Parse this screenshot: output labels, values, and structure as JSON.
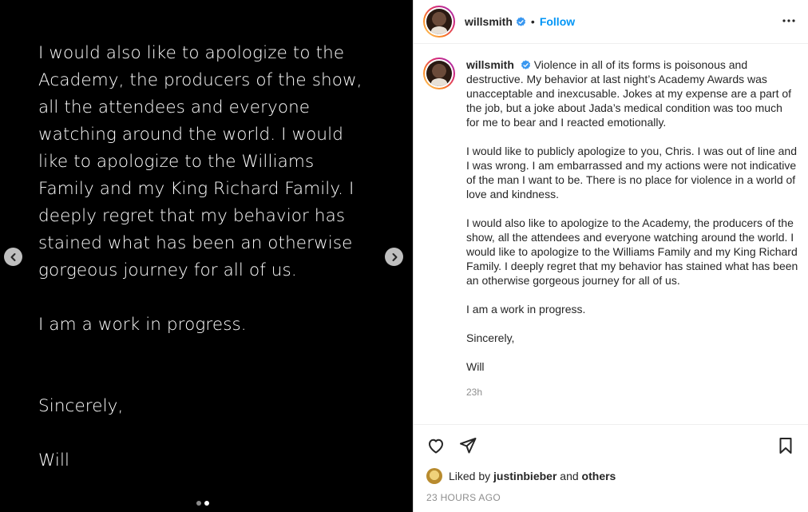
{
  "media": {
    "paragraphs": [
      "I would also like to apologize to the Academy, the producers of the show, all the attendees and everyone watching around the world. I would like to apologize to the Williams Family and my King Richard Family. I deeply regret that my behavior has stained what has been an otherwise gorgeous journey for all of us.",
      "I am a work in progress.",
      "Sincerely,",
      "Will"
    ],
    "prev_icon": "chevron-left-icon",
    "next_icon": "chevron-right-icon",
    "slide_count": 2,
    "active_slide": 2
  },
  "post": {
    "username": "willsmith",
    "follow_label": "Follow",
    "separator": "•",
    "caption": {
      "username": "willsmith",
      "first": "Violence in all of its forms is poisonous and destructive. My behavior at last night’s Academy Awards was unacceptable and inexcusable. Jokes at my expense are a part of the job, but a joke about Jada’s medical condition was too much for me to bear and I reacted emotionally.",
      "p2": "I would like to publicly apologize to you, Chris. I was out of line and I was wrong. I am embarrassed and my actions were not indicative of the man I want to be. There is no place for violence in a world of love and kindness.",
      "p3": "I would also like to apologize to the Academy, the producers of the show, all the attendees and everyone watching around the world. I would like to apologize to the Williams Family and my King Richard Family. I deeply regret that my behavior has stained what has been an otherwise gorgeous journey for all of us.",
      "p4": "I am a work in progress.",
      "p5": "Sincerely,",
      "p6": "Will",
      "time": "23h"
    },
    "likes": {
      "prefix": "Liked by",
      "user": "justinbieber",
      "and": "and",
      "others": "others"
    },
    "time_ago": "23 HOURS AGO"
  },
  "colors": {
    "accent": "#0095f6",
    "verified": "#3897f0",
    "text": "#262626",
    "muted": "#8e8e8e"
  }
}
